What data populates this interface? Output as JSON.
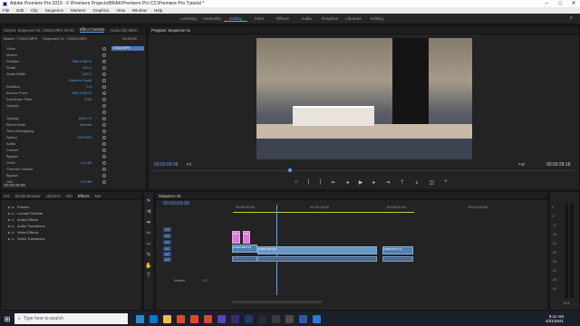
{
  "window": {
    "title": "Adobe Premiere Pro 2019 - F:\\Premiere Projects\\BRAK\\Premiere Pro CC\\Premiere Pro Tutorial *"
  },
  "menu": [
    "File",
    "Edit",
    "Clip",
    "Sequence",
    "Markers",
    "Graphics",
    "View",
    "Window",
    "Help"
  ],
  "workspaces": [
    "Learning",
    "Assembly",
    "Editing",
    "Color",
    "Effects",
    "Audio",
    "Graphics",
    "Libraries",
    "Editing"
  ],
  "workspace_active": 2,
  "source_panel": {
    "tabs": [
      "Source: Sequence 01: C0022.MP4: 00:00:06:17",
      "Effect Controls",
      "Audio Clip Mixer"
    ],
    "master_label": "Master * C0022.MP4",
    "seq_label": "Sequence 01 * C0022.MP4",
    "tc": "00:00:00",
    "clip_label": "C0022.MP4"
  },
  "effect_controls": [
    {
      "label": "Video",
      "value": ""
    },
    {
      "label": "Motion",
      "value": ""
    },
    {
      "label": "Position",
      "value": "960.0   540.0"
    },
    {
      "label": "Scale",
      "value": "100.0"
    },
    {
      "label": "Scale Width",
      "value": "100.0"
    },
    {
      "label": "",
      "value": "Uniform Scale"
    },
    {
      "label": "Rotation",
      "value": "0.0"
    },
    {
      "label": "Anchor Point",
      "value": "960.0   540.0"
    },
    {
      "label": "Anti-flicker Filter",
      "value": "0.00"
    },
    {
      "label": "Opacity",
      "value": ""
    },
    {
      "label": "",
      "value": ""
    },
    {
      "label": "Opacity",
      "value": "100.0 %"
    },
    {
      "label": "Blend Mode",
      "value": "Normal"
    },
    {
      "label": "Time Remapping",
      "value": ""
    },
    {
      "label": "Speed",
      "value": "100.00%"
    },
    {
      "label": "Audio",
      "value": ""
    },
    {
      "label": "Volume",
      "value": ""
    },
    {
      "label": "Bypass",
      "value": ""
    },
    {
      "label": "Level",
      "value": "0.0 dB"
    },
    {
      "label": "Channel Volume",
      "value": ""
    },
    {
      "label": "Bypass",
      "value": ""
    },
    {
      "label": "Left",
      "value": "0.0 dB"
    }
  ],
  "ec_timecode": "00:00:09:09",
  "program": {
    "tab": "Program: Sequence 01",
    "tc_left": "00:00:09:09",
    "fit": "Fit",
    "full": "Full",
    "tc_right": "00:00:28:18"
  },
  "project_panel": {
    "tabs": [
      "ries",
      "Media Browser",
      "Libraries",
      "Info",
      "Effects",
      "Mar"
    ],
    "items": [
      "Presets",
      "Lumetri Presets",
      "Audio Effects",
      "Audio Transitions",
      "Video Effects",
      "Video Transitions"
    ]
  },
  "timeline": {
    "tab": "Sequence 01",
    "tc": "00:00:09:09",
    "ruler": [
      "00:00:00:00",
      "00:00:15:00",
      "00:00:30:00",
      "00:00:45:00"
    ],
    "tracks": [
      "V3",
      "V2",
      "V1",
      "A1",
      "A2",
      "A3",
      "Master"
    ],
    "master_val": "0.0",
    "clips": {
      "v1_a": "C0022.MP4 [V]",
      "v1_b": "C0022.MP4 [V]",
      "v1_c": "C0023.MP4 [V]",
      "pink_a": "Title",
      "pink_b": "Title"
    }
  },
  "audio_meter": {
    "labels": [
      "0",
      "-6",
      "-12",
      "-18",
      "-24",
      "-30",
      "-36",
      "-42",
      "-48",
      "-54"
    ],
    "foot": "S S"
  },
  "taskbar": {
    "search": "Type here to search",
    "time": "8:11 AM",
    "date": "2/21/2021"
  }
}
